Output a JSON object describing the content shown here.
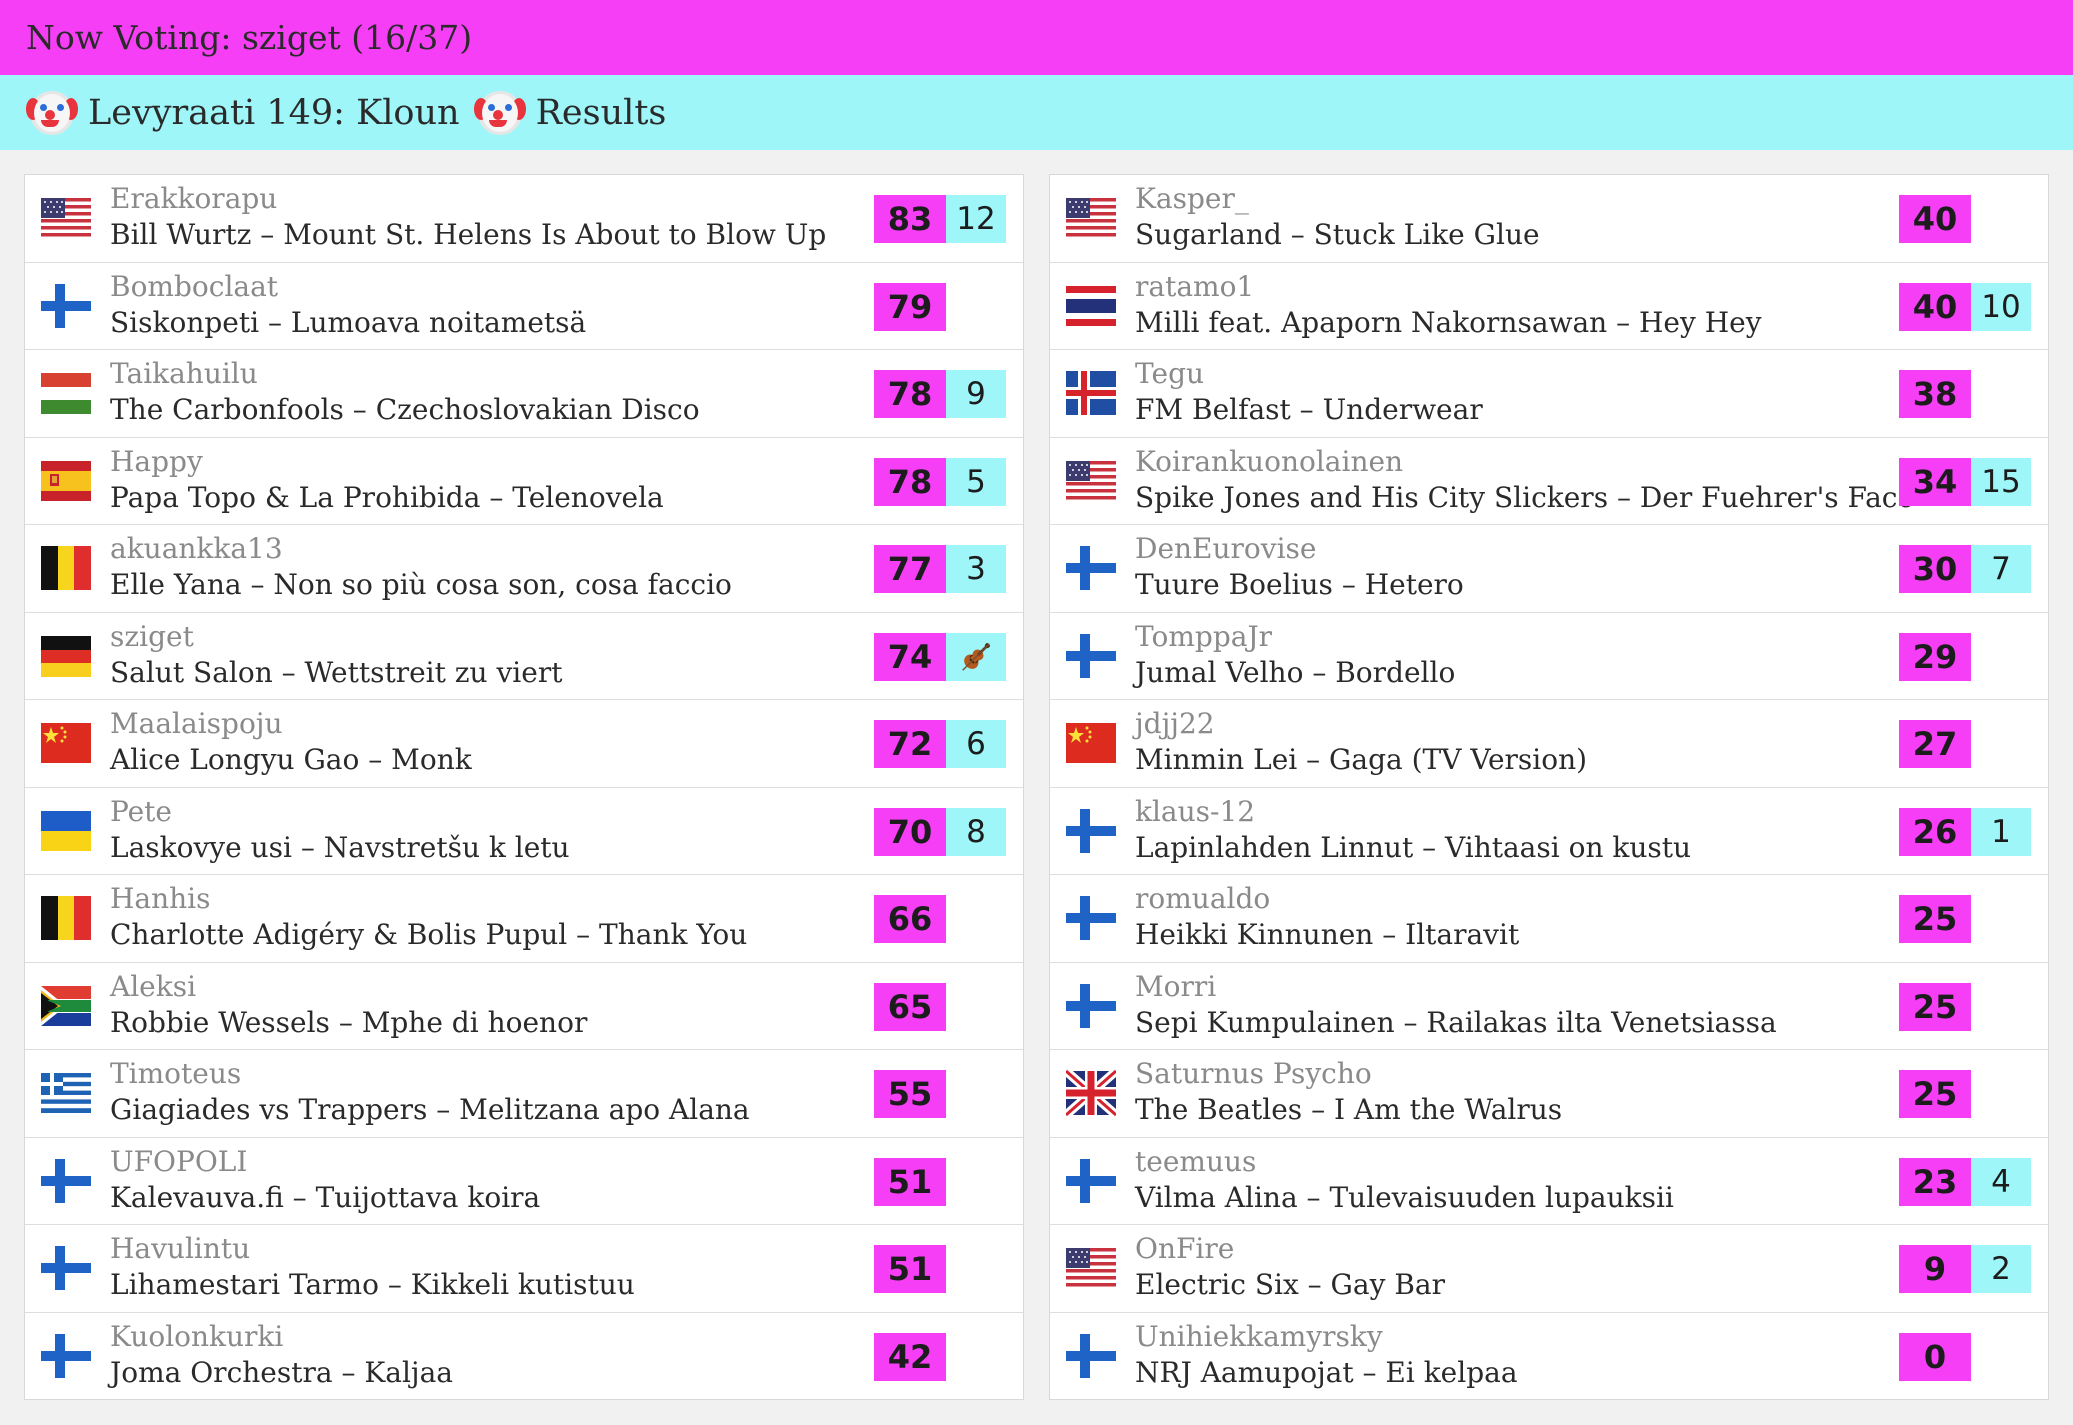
{
  "header": {
    "title": "Now Voting: sziget (16/37)",
    "subtitle": "Levyraati 149: Kloun",
    "results_label": "Results"
  },
  "left": [
    {
      "user": "Erakkorapu",
      "song": "Bill Wurtz – Mount St. Helens Is About to Blow Up",
      "score": "83",
      "bonus": "12",
      "flag": "us"
    },
    {
      "user": "Bomboclaat",
      "song": "Siskonpeti – Lumoava noitametsä",
      "score": "79",
      "bonus": "",
      "flag": "fi"
    },
    {
      "user": "Taikahuilu",
      "song": "The Carbonfools – Czechoslovakian Disco",
      "score": "78",
      "bonus": "9",
      "flag": "hu"
    },
    {
      "user": "Happy",
      "song": "Papa Topo & La Prohibida – Telenovela",
      "score": "78",
      "bonus": "5",
      "flag": "es"
    },
    {
      "user": "akuankka13",
      "song": "Elle Yana – Non so più cosa son, cosa faccio",
      "score": "77",
      "bonus": "3",
      "flag": "be"
    },
    {
      "user": "sziget",
      "song": "Salut Salon – Wettstreit zu viert",
      "score": "74",
      "bonus": "violin",
      "flag": "de"
    },
    {
      "user": "Maalaispoju",
      "song": "Alice Longyu Gao – Monk",
      "score": "72",
      "bonus": "6",
      "flag": "cn"
    },
    {
      "user": "Pete",
      "song": "Laskovye usi – Navstretšu k letu",
      "score": "70",
      "bonus": "8",
      "flag": "ua"
    },
    {
      "user": "Hanhis",
      "song": "Charlotte Adigéry & Bolis Pupul – Thank You",
      "score": "66",
      "bonus": "",
      "flag": "be"
    },
    {
      "user": "Aleksi",
      "song": "Robbie Wessels – Mphe di hoenor",
      "score": "65",
      "bonus": "",
      "flag": "za"
    },
    {
      "user": "Timoteus",
      "song": "Giagiades vs Trappers – Melitzana apo Alana",
      "score": "55",
      "bonus": "",
      "flag": "gr"
    },
    {
      "user": "UFOPOLI",
      "song": "Kalevauva.fi – Tuijottava koira",
      "score": "51",
      "bonus": "",
      "flag": "fi"
    },
    {
      "user": "Havulintu",
      "song": "Lihamestari Tarmo – Kikkeli kutistuu",
      "score": "51",
      "bonus": "",
      "flag": "fi"
    },
    {
      "user": "Kuolonkurki",
      "song": "Joma Orchestra – Kaljaa",
      "score": "42",
      "bonus": "",
      "flag": "fi"
    }
  ],
  "right": [
    {
      "user": "Kasper_",
      "song": "Sugarland – Stuck Like Glue",
      "score": "40",
      "bonus": "",
      "flag": "us"
    },
    {
      "user": "ratamo1",
      "song": "Milli feat. Apaporn Nakornsawan – Hey Hey",
      "score": "40",
      "bonus": "10",
      "flag": "th"
    },
    {
      "user": "Tegu",
      "song": "FM Belfast – Underwear",
      "score": "38",
      "bonus": "",
      "flag": "is"
    },
    {
      "user": "Koirankuonolainen",
      "song": "Spike Jones and His City Slickers – Der Fuehrer's Face",
      "score": "34",
      "bonus": "15",
      "flag": "us"
    },
    {
      "user": "DenEurovise",
      "song": "Tuure Boelius – Hetero",
      "score": "30",
      "bonus": "7",
      "flag": "fi"
    },
    {
      "user": "TomppaJr",
      "song": "Jumal Velho – Bordello",
      "score": "29",
      "bonus": "",
      "flag": "fi"
    },
    {
      "user": "jdjj22",
      "song": "Minmin Lei – Gaga (TV Version)",
      "score": "27",
      "bonus": "",
      "flag": "cn"
    },
    {
      "user": "klaus-12",
      "song": "Lapinlahden Linnut – Vihtaasi on kustu",
      "score": "26",
      "bonus": "1",
      "flag": "fi"
    },
    {
      "user": "romualdo",
      "song": "Heikki Kinnunen – Iltaravit",
      "score": "25",
      "bonus": "",
      "flag": "fi"
    },
    {
      "user": "Morri",
      "song": "Sepi Kumpulainen – Railakas ilta Venetsiassa",
      "score": "25",
      "bonus": "",
      "flag": "fi"
    },
    {
      "user": "Saturnus Psycho",
      "song": "The Beatles – I Am the Walrus",
      "score": "25",
      "bonus": "",
      "flag": "gb"
    },
    {
      "user": "teemuus",
      "song": "Vilma Alina – Tulevaisuuden lupauksii",
      "score": "23",
      "bonus": "4",
      "flag": "fi"
    },
    {
      "user": "OnFire",
      "song": "Electric Six – Gay Bar",
      "score": "9",
      "bonus": "2",
      "flag": "us"
    },
    {
      "user": "Unihiekkamyrsky",
      "song": "NRJ Aamupojat – Ei kelpaa",
      "score": "0",
      "bonus": "",
      "flag": "fi"
    }
  ]
}
